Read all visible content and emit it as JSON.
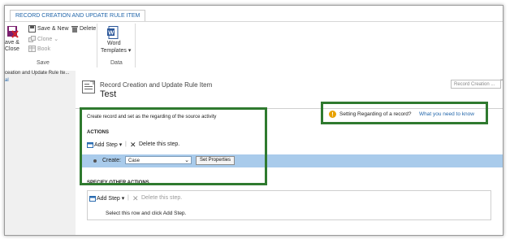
{
  "ribbon": {
    "tab_label": "RECORD CREATION AND UPDATE RULE ITEM",
    "save_close_line1": "ave &",
    "save_close_line2": "Close",
    "save_new": "Save & New",
    "delete": "Delete",
    "clone": "Clone ⌄",
    "book": "Book",
    "word_templates_line1": "Word",
    "word_templates_line2": "Templates ▾",
    "group_save": "Save",
    "group_data": "Data"
  },
  "leftnav": {
    "breadcrumb": "ceation and Update Rule Ite...",
    "selected": "al"
  },
  "header": {
    "subtitle": "Record Creation and Update Rule Item",
    "title": "Test",
    "record_dropdown": "Record Creation ..."
  },
  "notice": {
    "text": "Setting Regarding of a record?",
    "link": "What you need to know",
    "color": "#e8a100"
  },
  "content": {
    "description": "Create record and set as the regarding of the source activity",
    "actions_heading": "ACTIONS",
    "add_step_label": "Add Step ▾",
    "delete_step_label": "Delete this step.",
    "create_label": "Create:",
    "create_value": "Case",
    "set_properties": "Set Properties",
    "other_actions_heading": "SPECIFY OTHER ACTIONS",
    "add_step_label_2": "Add Step ▾",
    "delete_step_label_2": "Delete this step.",
    "select_row_hint": "Select this row and click Add Step."
  },
  "colors": {
    "highlight_row": "#a9cbeb",
    "callout_border": "#2f7a2f",
    "link": "#2266aa"
  }
}
